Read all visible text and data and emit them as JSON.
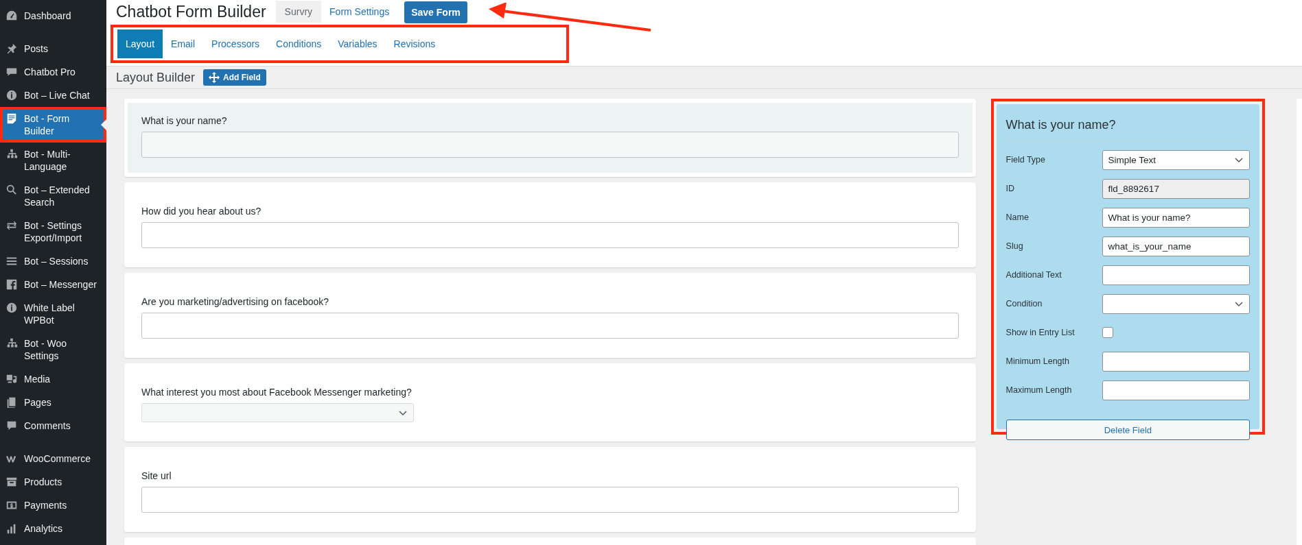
{
  "sidebar": {
    "groups": [
      {
        "items": [
          {
            "label": "Dashboard",
            "selected": false
          }
        ]
      },
      {
        "items": [
          {
            "label": "Posts",
            "selected": false
          },
          {
            "label": "Chatbot Pro",
            "selected": false
          },
          {
            "label": "Bot – Live Chat",
            "selected": false
          },
          {
            "label": "Bot - Form Builder",
            "selected": true
          },
          {
            "label": "Bot - Multi-Language",
            "selected": false
          },
          {
            "label": "Bot – Extended Search",
            "selected": false
          },
          {
            "label": "Bot - Settings Export/Import",
            "selected": false
          },
          {
            "label": "Bot – Sessions",
            "selected": false
          },
          {
            "label": "Bot – Messenger",
            "selected": false
          },
          {
            "label": "White Label WPBot",
            "selected": false
          },
          {
            "label": "Bot - Woo Settings",
            "selected": false
          },
          {
            "label": "Media",
            "selected": false
          },
          {
            "label": "Pages",
            "selected": false
          },
          {
            "label": "Comments",
            "selected": false
          }
        ]
      },
      {
        "items": [
          {
            "label": "WooCommerce",
            "selected": false
          },
          {
            "label": "Products",
            "selected": false
          },
          {
            "label": "Payments",
            "selected": false
          },
          {
            "label": "Analytics",
            "selected": false
          }
        ]
      }
    ]
  },
  "header": {
    "title": "Chatbot Form Builder",
    "form_name": "Survry",
    "settings_link": "Form Settings",
    "save_button": "Save Form"
  },
  "tabs": [
    {
      "label": "Layout",
      "selected": true
    },
    {
      "label": "Email",
      "selected": false
    },
    {
      "label": "Processors",
      "selected": false
    },
    {
      "label": "Conditions",
      "selected": false
    },
    {
      "label": "Variables",
      "selected": false
    },
    {
      "label": "Revisions",
      "selected": false
    }
  ],
  "toolbar": {
    "title": "Layout Builder",
    "add_button": "Add Field"
  },
  "fields": [
    {
      "label": "What is your name?",
      "kind": "text",
      "selected": true
    },
    {
      "label": "How did you hear about us?",
      "kind": "text",
      "selected": false
    },
    {
      "label": "Are you marketing/advertising on facebook?",
      "kind": "text",
      "selected": false
    },
    {
      "label": "What interest you most about Facebook Messenger marketing?",
      "kind": "select",
      "selected": false
    },
    {
      "label": "Site url",
      "kind": "text",
      "selected": false
    }
  ],
  "panel": {
    "title": "What is your name?",
    "rows": [
      {
        "label": "Field Type",
        "kind": "select",
        "value": "Simple Text"
      },
      {
        "label": "ID",
        "kind": "readonly",
        "value": "fld_8892617"
      },
      {
        "label": "Name",
        "kind": "text",
        "value": "What is your name?"
      },
      {
        "label": "Slug",
        "kind": "text",
        "value": "what_is_your_name"
      },
      {
        "label": "Additional Text",
        "kind": "text"
      },
      {
        "label": "Condition",
        "kind": "select"
      },
      {
        "label": "Show in Entry List",
        "kind": "checkbox",
        "checked": false
      },
      {
        "label": "Minimum Length",
        "kind": "text"
      },
      {
        "label": "Maximum Length",
        "kind": "text"
      }
    ],
    "delete_button": "Delete Field"
  }
}
